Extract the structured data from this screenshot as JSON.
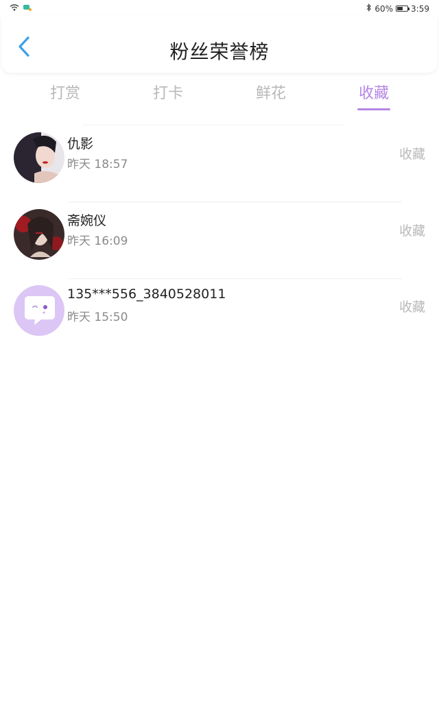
{
  "status_bar": {
    "battery": "60%",
    "battery_level": 0.6,
    "time": "3:59",
    "icons": [
      "wifi-icon",
      "notification-icon",
      "bluetooth-icon",
      "battery-icon"
    ]
  },
  "header": {
    "title": "粉丝荣誉榜",
    "back_icon": "chevron-left-icon"
  },
  "tabs": [
    {
      "label": "打赏",
      "active": false
    },
    {
      "label": "打卡",
      "active": false
    },
    {
      "label": "鲜花",
      "active": false
    },
    {
      "label": "收藏",
      "active": true
    }
  ],
  "list": [
    {
      "name": "仇影",
      "time": "昨天 18:57",
      "action": "收藏",
      "avatar": "photo-avatar"
    },
    {
      "name": "斋婉仪",
      "time": "昨天 16:09",
      "action": "收藏",
      "avatar": "illustration-avatar"
    },
    {
      "name": "135***556_3840528011",
      "time": "昨天 15:50",
      "action": "收藏",
      "avatar": "chat-bubble-avatar"
    }
  ],
  "colors": {
    "accent": "#b585e6",
    "back_arrow": "#3aa0e8",
    "inactive_text": "#b8b8b8"
  }
}
